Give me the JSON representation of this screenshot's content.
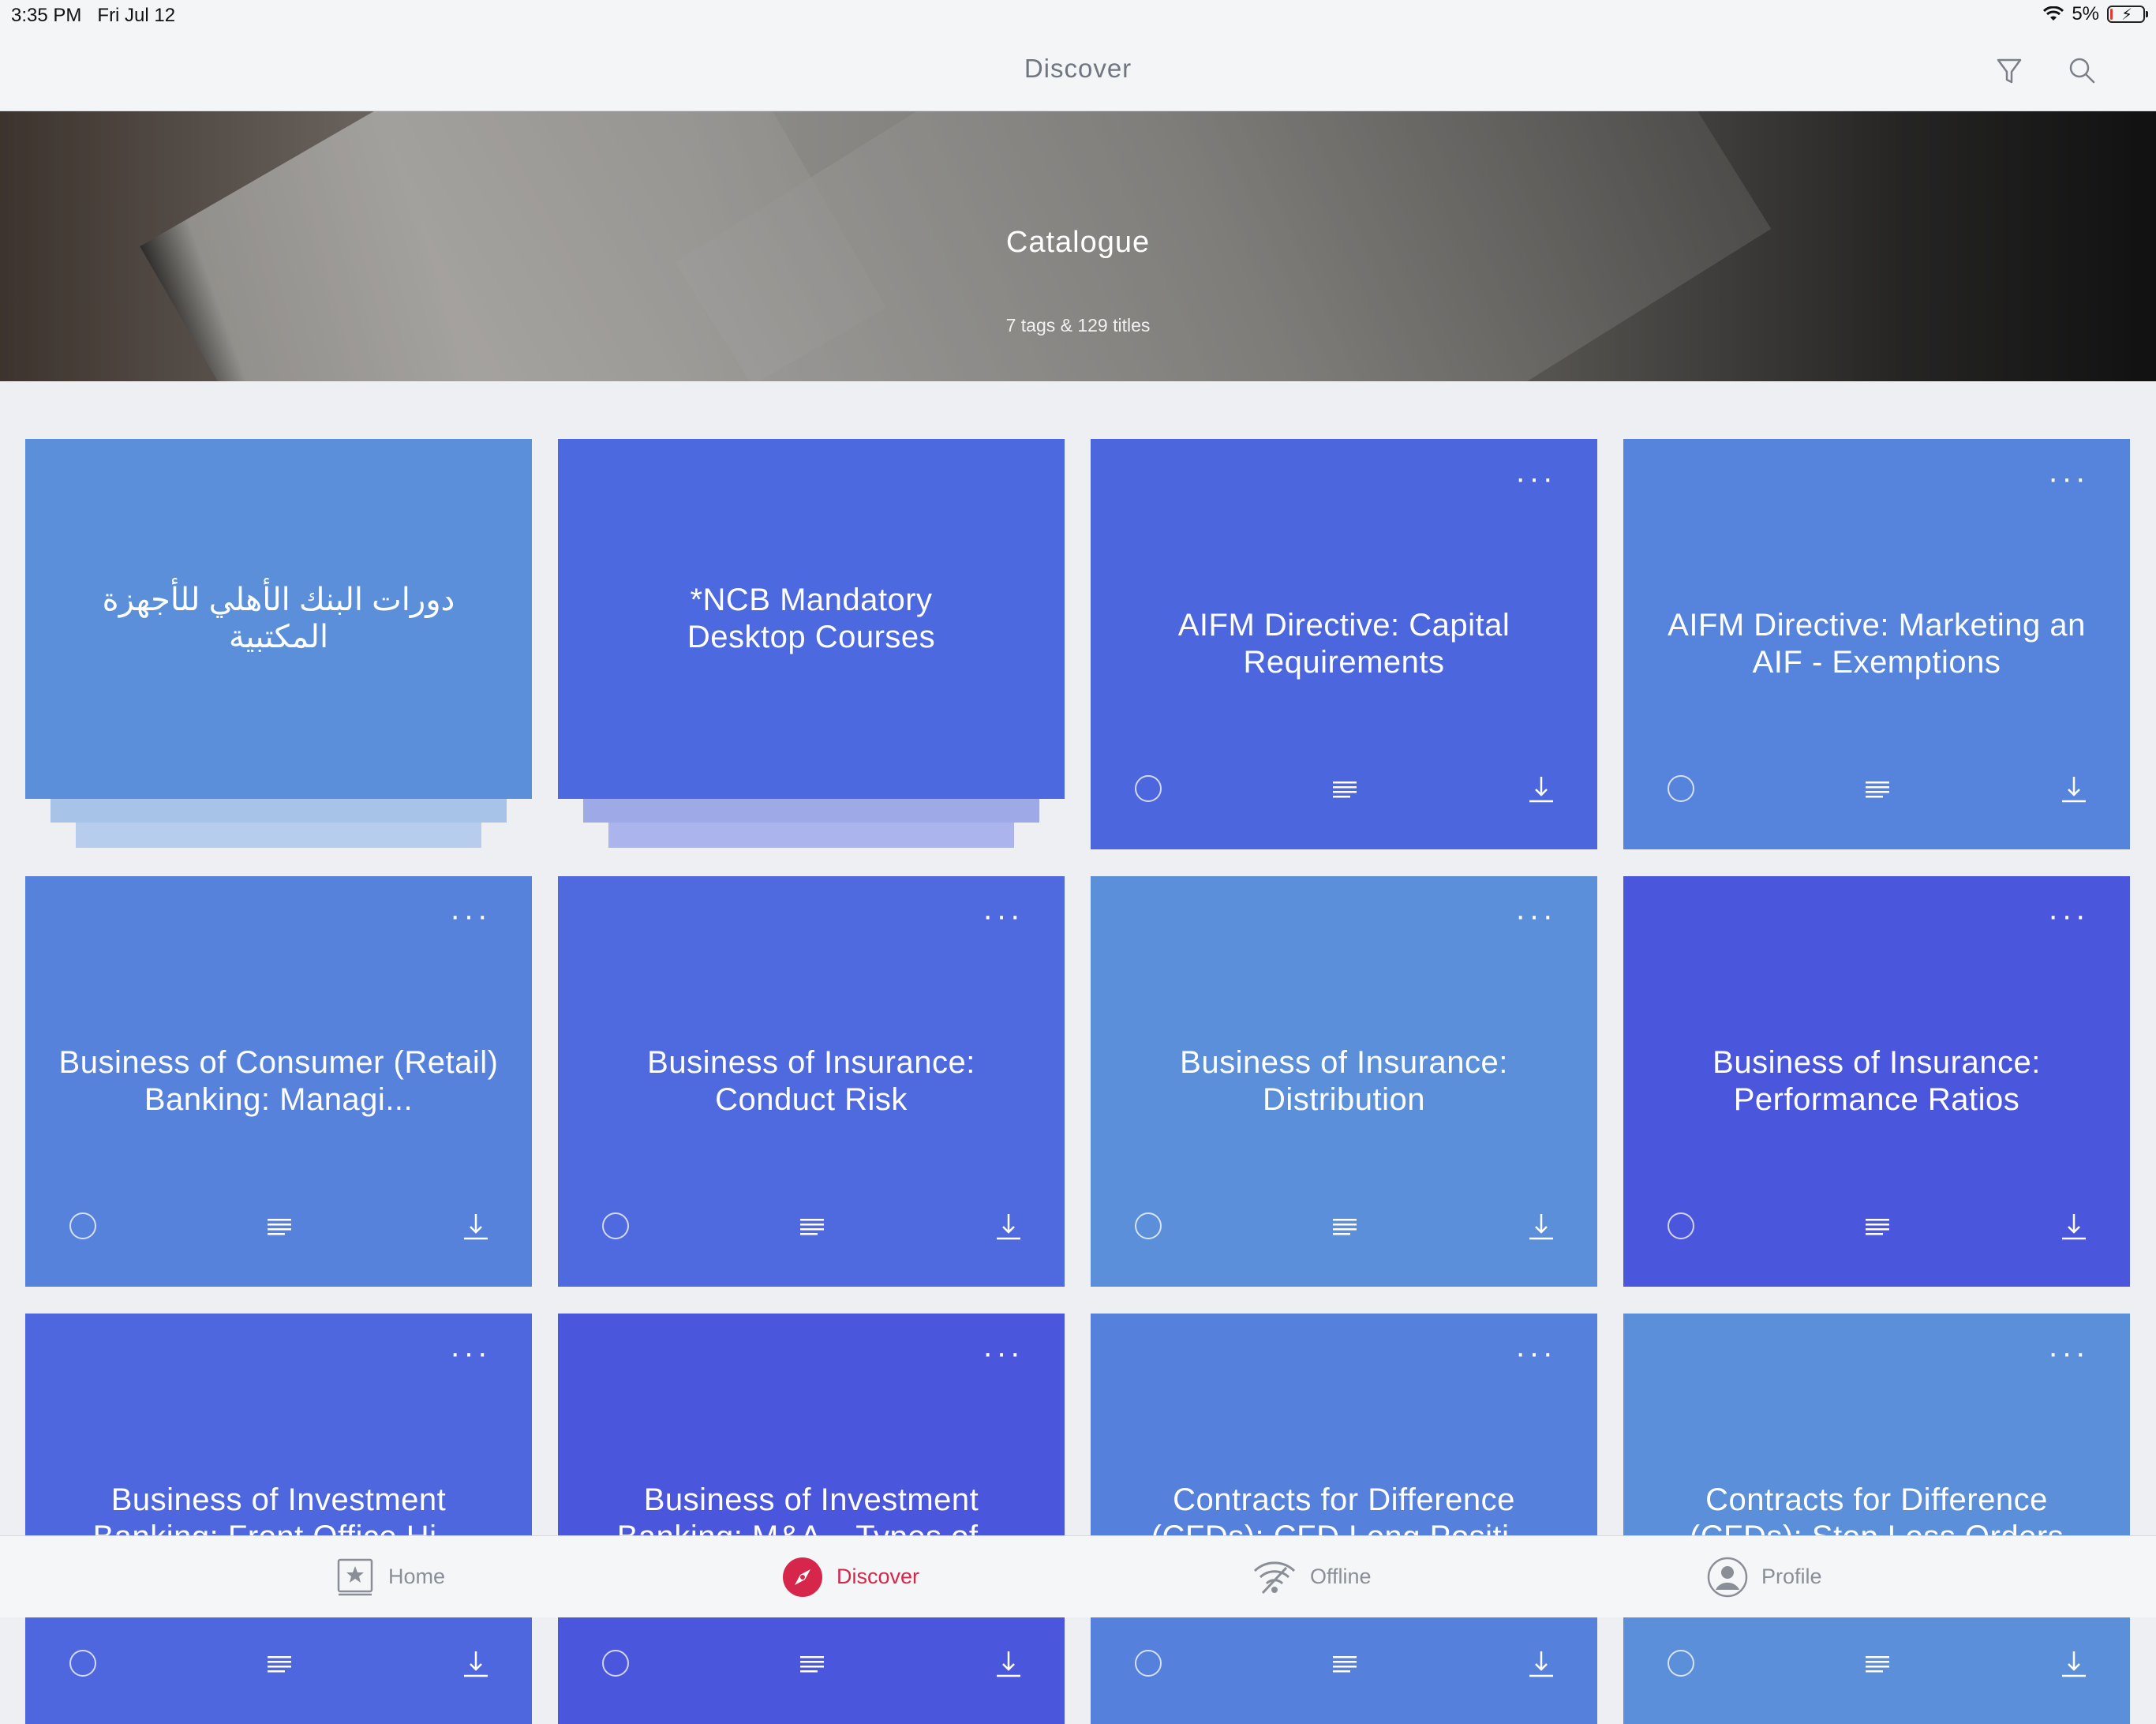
{
  "status_bar": {
    "time": "3:35 PM",
    "date": "Fri Jul 12",
    "battery": "5%",
    "battery_level": 0.05
  },
  "nav": {
    "title": "Discover",
    "filter_icon": "filter-icon",
    "search_icon": "search-icon"
  },
  "banner": {
    "title": "Catalogue",
    "subtitle": "7 tags & 129 titles"
  },
  "tiles": [
    {
      "title": "دورات البنك الأهلي للأجهزة المكتبية",
      "color": "#5b8fd9",
      "kind": "collection"
    },
    {
      "title": "*NCB Mandatory Desktop Courses",
      "color": "#4d69df",
      "kind": "collection"
    },
    {
      "title": "AIFM Directive: Capital Requirements",
      "color": "#4c67de",
      "kind": "course"
    },
    {
      "title": "AIFM Directive: Marketing an AIF - Exemptions",
      "color": "#5683dc",
      "kind": "course"
    },
    {
      "title": "Business of Consumer (Retail) Banking: Managi...",
      "color": "#5682dc",
      "kind": "course"
    },
    {
      "title": "Business of Insurance: Conduct Risk",
      "color": "#4f6ade",
      "kind": "course"
    },
    {
      "title": "Business of Insurance: Distribution",
      "color": "#5b8fd9",
      "kind": "course"
    },
    {
      "title": "Business of Insurance: Performance Ratios",
      "color": "#4a56dc",
      "kind": "course"
    },
    {
      "title": "Business of Investment Banking: Front Office Hi...",
      "color": "#4e67de",
      "kind": "course"
    },
    {
      "title": "Business of Investment Banking: M&A – Types of...",
      "color": "#4a56dc",
      "kind": "course"
    },
    {
      "title": "Contracts for Difference (CFDs): CFD Long Positi...",
      "color": "#5580dc",
      "kind": "course"
    },
    {
      "title": "Contracts for Difference (CFDs): Stop Loss Orders",
      "color": "#5b8fd9",
      "kind": "course"
    }
  ],
  "tab_bar": {
    "items": [
      {
        "label": "Home",
        "icon": "home-star-icon"
      },
      {
        "label": "Discover",
        "icon": "compass-icon",
        "active": true
      },
      {
        "label": "Offline",
        "icon": "wifi-offline-icon"
      },
      {
        "label": "Profile",
        "icon": "profile-icon"
      }
    ]
  }
}
